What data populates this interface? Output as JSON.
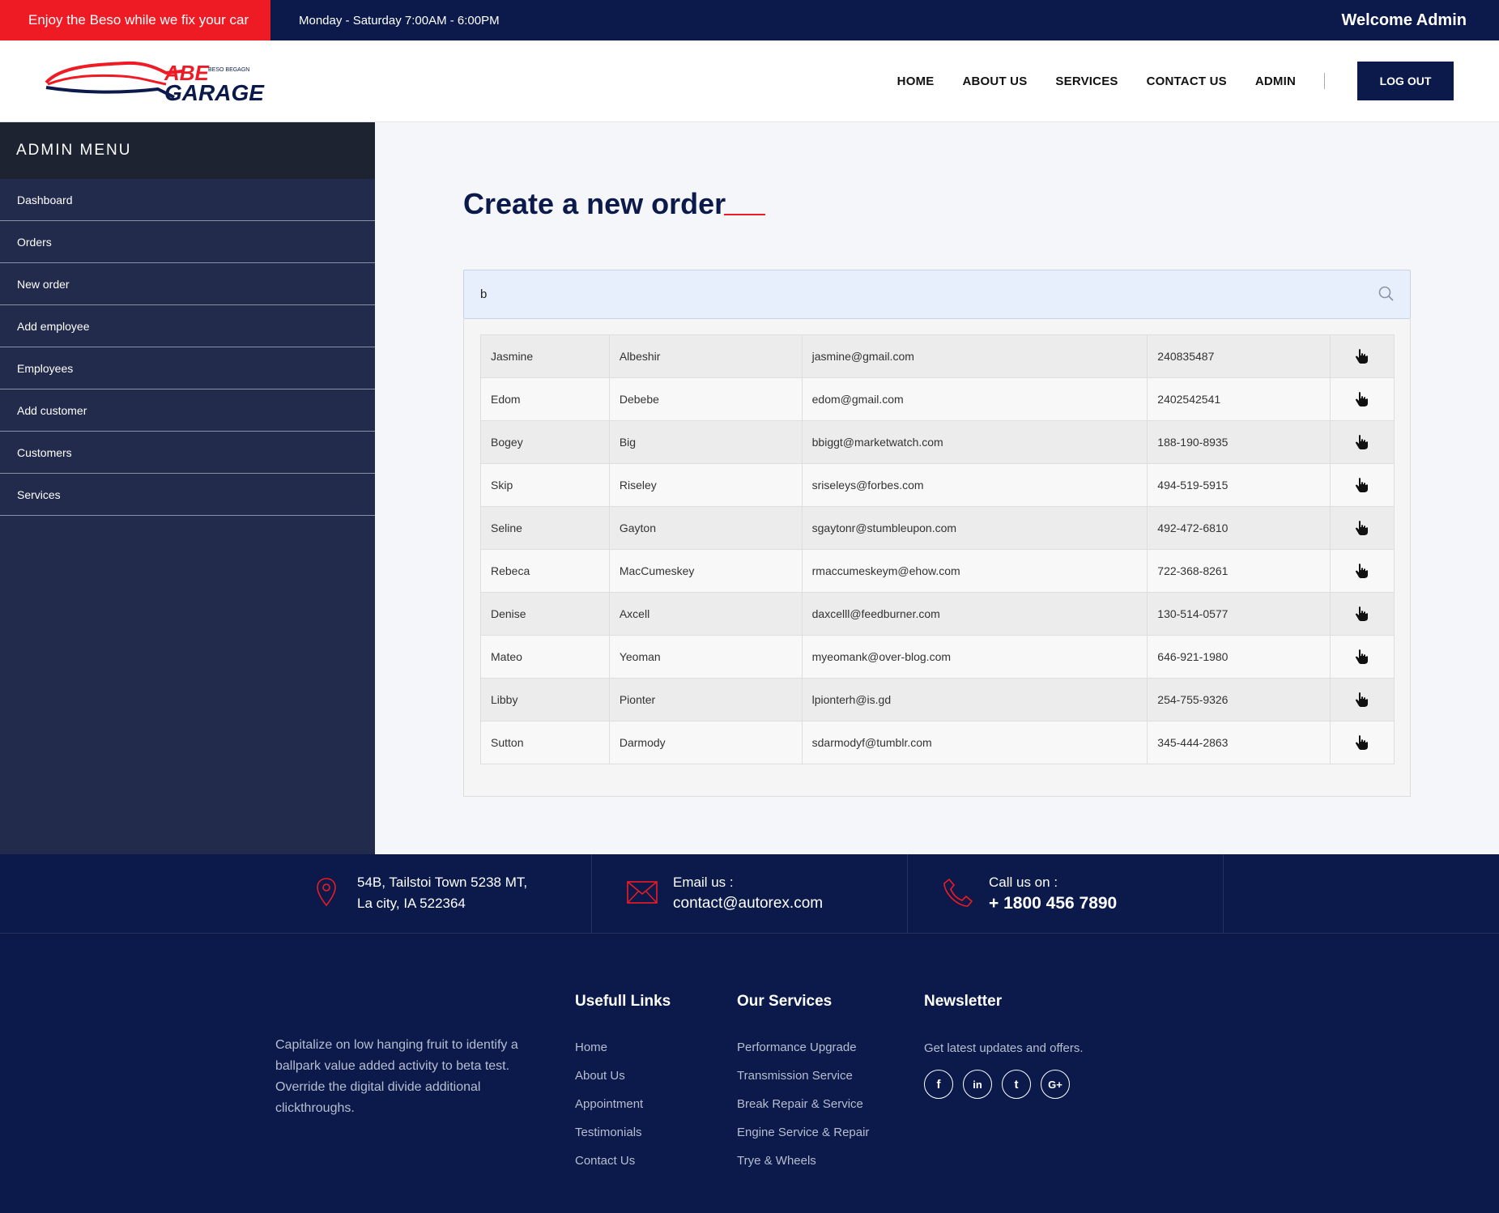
{
  "topbar": {
    "promo": "Enjoy the Beso while we fix your car",
    "hours": "Monday - Saturday 7:00AM - 6:00PM",
    "welcome": "Welcome Admin"
  },
  "header": {
    "logo_main": "ABE",
    "logo_sub": "GARAGE",
    "logo_tagline": "BESO BEGAGN",
    "nav": [
      "HOME",
      "ABOUT US",
      "SERVICES",
      "CONTACT US",
      "ADMIN"
    ],
    "logout": "LOG OUT"
  },
  "sidebar": {
    "title": "ADMIN MENU",
    "items": [
      "Dashboard",
      "Orders",
      "New order",
      "Add employee",
      "Employees",
      "Add customer",
      "Customers",
      "Services"
    ]
  },
  "main": {
    "title": "Create a new order",
    "search_value": "b",
    "customers": [
      [
        "Jasmine",
        "Albeshir",
        "jasmine@gmail.com",
        "240835487"
      ],
      [
        "Edom",
        "Debebe",
        "edom@gmail.com",
        "2402542541"
      ],
      [
        "Bogey",
        "Big",
        "bbiggt@marketwatch.com",
        "188-190-8935"
      ],
      [
        "Skip",
        "Riseley",
        "sriseleys@forbes.com",
        "494-519-5915"
      ],
      [
        "Seline",
        "Gayton",
        "sgaytonr@stumbleupon.com",
        "492-472-6810"
      ],
      [
        "Rebeca",
        "MacCumeskey",
        "rmaccumeskeym@ehow.com",
        "722-368-8261"
      ],
      [
        "Denise",
        "Axcell",
        "daxcelll@feedburner.com",
        "130-514-0577"
      ],
      [
        "Mateo",
        "Yeoman",
        "myeomank@over-blog.com",
        "646-921-1980"
      ],
      [
        "Libby",
        "Pionter",
        "lpionterh@is.gd",
        "254-755-9326"
      ],
      [
        "Sutton",
        "Darmody",
        "sdarmodyf@tumblr.com",
        "345-444-2863"
      ]
    ]
  },
  "contact": {
    "address_line1": "54B, Tailstoi Town 5238 MT,",
    "address_line2": "La city, IA 522364",
    "email_label": "Email us :",
    "email": "contact@autorex.com",
    "phone_label": "Call us on :",
    "phone": "+ 1800 456 7890"
  },
  "footer": {
    "about": "Capitalize on low hanging fruit to identify a ballpark value added activity to beta test. Override the digital divide additional clickthroughs.",
    "useful_title": "Usefull Links",
    "useful_links": [
      "Home",
      "About Us",
      "Appointment",
      "Testimonials",
      "Contact Us"
    ],
    "services_title": "Our Services",
    "services_links": [
      "Performance Upgrade",
      "Transmission Service",
      "Break Repair & Service",
      "Engine Service & Repair",
      "Trye & Wheels"
    ],
    "newsletter_title": "Newsletter",
    "newsletter_text": "Get latest updates and offers.",
    "social": [
      "f",
      "in",
      "t",
      "G+"
    ]
  },
  "colors": {
    "navy": "#0b1a4a",
    "red": "#ee1b24",
    "sidebar": "#222b4b"
  }
}
